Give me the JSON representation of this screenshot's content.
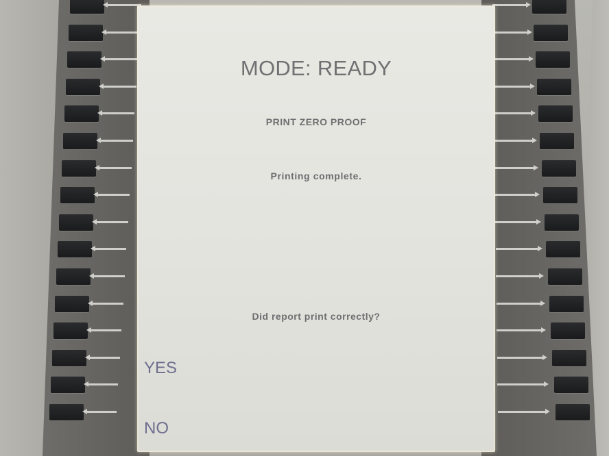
{
  "screen": {
    "mode_title": "MODE: READY",
    "sub_title": "PRINT ZERO PROOF",
    "status": "Printing complete.",
    "question": "Did report print correctly?",
    "yes_label": "YES",
    "no_label": "NO"
  },
  "colors": {
    "screen_background": "#e6e6e1",
    "text": "#6e6e70",
    "choice_text": "#6e6e90",
    "bezel": "#62615e",
    "key": "#1e1f20",
    "arrow": "#cfcfcb"
  },
  "icons": {
    "left_key_arrow": "arrow-left-icon",
    "right_key_arrow": "arrow-right-icon"
  }
}
